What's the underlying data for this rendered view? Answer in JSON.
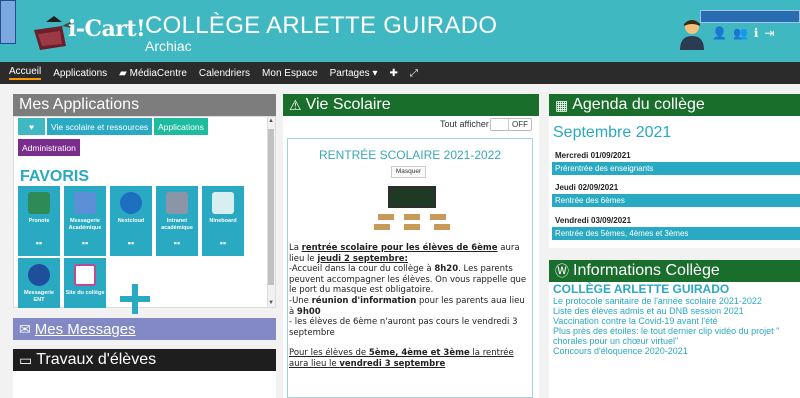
{
  "header": {
    "logo_text": "i-Cart!",
    "title": "COLLÈGE ARLETTE GUIRADO",
    "subtitle": "Archiac",
    "user_icons": [
      "users-icon",
      "group-icon",
      "info-icon",
      "logout-icon"
    ]
  },
  "navbar": {
    "items": [
      "Accueil",
      "Applications",
      "MédiaCentre",
      "Calendriers",
      "Mon Espace",
      "Partages ▾",
      "✚",
      "⤢"
    ]
  },
  "apps": {
    "title": "Mes Applications",
    "chips": [
      "♥",
      "Vie scolaire et ressources",
      "Applications",
      "Administration"
    ],
    "favoris_title": "FAVORIS",
    "tiles": [
      {
        "label": "Pronote",
        "icon": "pronote-icon"
      },
      {
        "label": "Messagerie Académique",
        "icon": "mail-icon"
      },
      {
        "label": "Nextcloud",
        "icon": "nextcloud-icon"
      },
      {
        "label": "Intranet académique",
        "icon": "intranet-icon"
      },
      {
        "label": "Nineboard",
        "icon": "nineboard-icon"
      },
      {
        "label": "Messagerie ENT",
        "icon": "message-icon"
      },
      {
        "label": "Site du collège",
        "icon": "site-icon"
      }
    ]
  },
  "messages": {
    "title": "Mes Messages"
  },
  "travaux": {
    "title": "Travaux d'élèves"
  },
  "vie_scolaire": {
    "title": "Vie Scolaire",
    "toggle_label": "Tout afficher",
    "toggle_state": "OFF",
    "news_title": "RENTRÉE SCOLAIRE 2021-2022",
    "hide_button": "Masquer",
    "p1_prefix": "La ",
    "p1_bold": "rentrée scolaire pour les élèves de 6ème",
    "p1_suffix": " aura lieu le ",
    "p1_date": "jeudi 2 septembre:",
    "p2": "-Accueil dans la cour du collège à ",
    "p2_time": "8h20",
    "p2_rest": ". Les parents peuvent accompagner les élèves. On vous rappelle que le port du masque est obligatoire.",
    "p3_prefix": "-Une ",
    "p3_bold": "réunion d'information",
    "p3_rest": " pour les parents aua lieu à ",
    "p3_time": "9h00",
    "p4": "- les élèves de 6ème n'auront pas cours le vendredi 3 septembre",
    "p5_prefix": "Pour les élèves de ",
    "p5_bold": "5ème, 4ème et 3ème",
    "p5_rest": " la rentrée aura lieu le ",
    "p5_date": "vendredi 3 septembre"
  },
  "agenda": {
    "title": "Agenda du collège",
    "month": "Septembre 2021",
    "events": [
      {
        "date": "Mercredi 01/09/2021",
        "title": "Prérentrée des enseignants"
      },
      {
        "date": "Jeudi 02/09/2021",
        "title": "Rentrée des 6èmes"
      },
      {
        "date": "Vendredi 03/09/2021",
        "title": "Rentrée des 5èmes, 4èmes et 3èmes"
      }
    ]
  },
  "infos": {
    "title": "Informations Collège",
    "section_title": "COLLÈGE ARLETTE GUIRADO",
    "items": [
      "Le protocole sanitaire de l'année scolaire 2021-2022",
      "Liste des élèves admis et au DNB session 2021",
      "Vaccination contre la Covid-19 avant l'été",
      "Plus près des étoiles: le tout dernier clip vidéo du projet \"",
      "chorales pour un chœur virtuel\"",
      "Concours d'éloquence 2020-2021"
    ]
  },
  "colors": {
    "header": "#3fb8c1",
    "accent": "#2aa9c2",
    "panel_green": "#1a6e2c",
    "panel_grey": "#7d7d7d",
    "panel_purple": "#8389c4",
    "chip_pink": "#e05a8a",
    "chip_purple": "#7b2d8e",
    "chip_teal": "#1ebc9e"
  }
}
